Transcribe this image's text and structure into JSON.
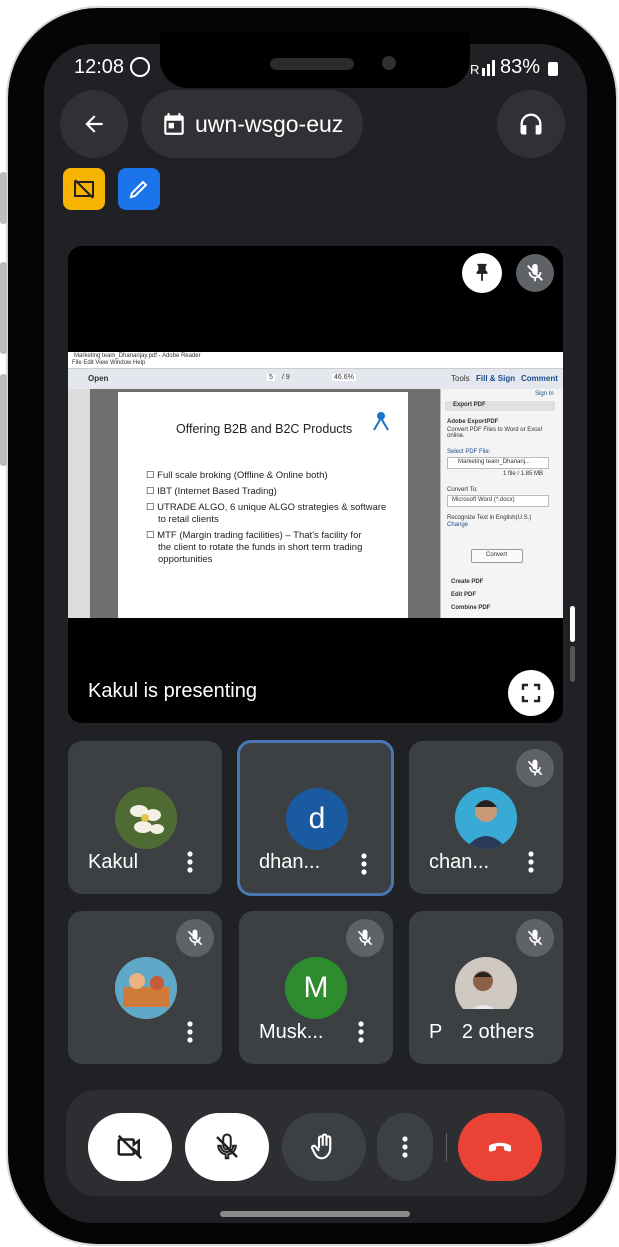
{
  "status_bar": {
    "time": "12:08",
    "battery": "83%"
  },
  "header": {
    "meeting_code": "uwn-wsgo-euz"
  },
  "presentation": {
    "presenter_label": "Kakul is presenting",
    "shared_window_title": "Marketing team_Dhananjay.pdf - Adobe Reader",
    "menu": [
      "File",
      "Edit",
      "View",
      "Window",
      "Help"
    ],
    "toolbar": {
      "open": "Open",
      "page": "5",
      "of": "/ 9",
      "zoom": "46.6%",
      "tools": "Tools",
      "fill_sign": "Fill & Sign",
      "comment": "Comment"
    },
    "slide_title": "Offering B2B and B2C Products",
    "bullets": [
      "Full scale broking (Offline & Online both)",
      "IBT (Internet Based Trading)",
      "UTRADE ALGO, 6 unique ALGO strategies & software",
      "to retail clients",
      "MTF (Margin trading facilities) – That's facility for",
      "the client to rotate the funds in short term trading",
      "opportunities"
    ],
    "side_panel": {
      "sign_in": "Sign In",
      "export_pdf": "Export PDF",
      "adobe_export": "Adobe ExportPDF",
      "desc": "Convert PDF Files to Word or Excel online.",
      "select_file": "Select PDF File:",
      "file_name": "Marketing team_Dhananj...",
      "file_info": "1 file / 1.85 MB",
      "convert_to": "Convert To:",
      "format": "Microsoft Word (*.docx)",
      "recognize": "Recognize Text in English(U.S.)",
      "change": "Change",
      "convert_btn": "Convert",
      "create_pdf": "Create PDF",
      "edit_pdf": "Edit PDF",
      "combine_pdf": "Combine PDF"
    }
  },
  "participants": [
    {
      "name": "Kakul",
      "initial": "",
      "avatar_color": "#5a7a3a",
      "muted": false
    },
    {
      "name": "dhan...",
      "initial": "d",
      "avatar_color": "#1a5aa0",
      "muted": false,
      "speaking": true
    },
    {
      "name": "chan...",
      "initial": "",
      "avatar_color": "#3a8ac0",
      "muted": true
    },
    {
      "name": "",
      "initial": "",
      "avatar_color": "#c07a3a",
      "muted": true
    },
    {
      "name": "Musk...",
      "initial": "M",
      "avatar_color": "#2e8b2e",
      "muted": true
    },
    {
      "name": "Pri",
      "initial": "",
      "avatar_color": "#b0a8a0",
      "muted": true
    }
  ],
  "others_badge": "2 others",
  "colors": {
    "background": "#202124",
    "tile": "#3c4043",
    "end_call": "#ea4335",
    "speaking_border": "#4a77b4"
  },
  "icons": {
    "back": "arrow-left-icon",
    "calendar": "calendar-icon",
    "audio": "headphones-icon",
    "pin": "pin-icon",
    "fullscreen": "fullscreen-icon",
    "camera": "camera-off-icon",
    "mic": "mic-off-icon",
    "hand": "raise-hand-icon",
    "more": "more-vert-icon",
    "end": "end-call-icon"
  }
}
